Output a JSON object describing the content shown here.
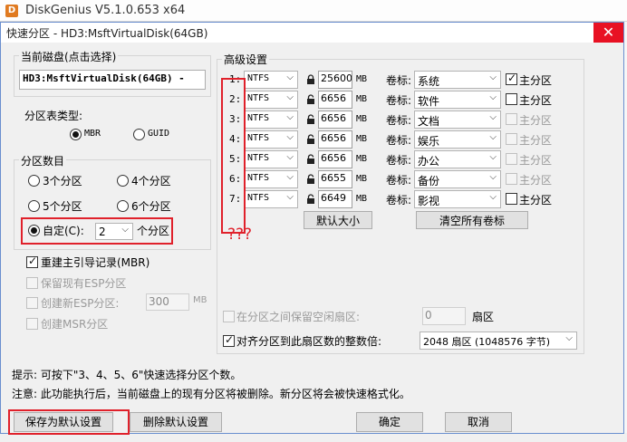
{
  "app": {
    "title": "DiskGenius V5.1.0.653 x64"
  },
  "dialog": {
    "title": "快速分区 - HD3:MsftVirtualDisk(64GB)",
    "close": "✕"
  },
  "disk": {
    "label": "当前磁盘(点击选择)",
    "value": "HD3:MsftVirtualDisk(64GB) -"
  },
  "table_type": {
    "label": "分区表类型:",
    "mbr": "MBR",
    "guid": "GUID",
    "selected": "MBR"
  },
  "count": {
    "label": "分区数目",
    "options": [
      "3个分区",
      "4个分区",
      "5个分区",
      "6个分区"
    ],
    "custom_label": "自定(C):",
    "custom_value": "2",
    "custom_suffix": "个分区"
  },
  "options": {
    "rebuild_mbr": "重建主引导记录(MBR)",
    "keep_esp": "保留现有ESP分区",
    "create_esp": "创建新ESP分区:",
    "esp_size": "300",
    "esp_unit": "MB",
    "create_msr": "创建MSR分区"
  },
  "advanced": {
    "label": "高级设置",
    "vol_label": "卷标:",
    "unit": "MB",
    "primary_label": "主分区",
    "rows": [
      {
        "index": "1:",
        "fs": "NTFS",
        "size": "25600",
        "locked": true,
        "label": "系统",
        "primary": true,
        "primary_enabled": true
      },
      {
        "index": "2:",
        "fs": "NTFS",
        "size": "6656",
        "locked": false,
        "label": "软件",
        "primary": false,
        "primary_enabled": true
      },
      {
        "index": "3:",
        "fs": "NTFS",
        "size": "6656",
        "locked": false,
        "label": "文档",
        "primary": false,
        "primary_enabled": false
      },
      {
        "index": "4:",
        "fs": "NTFS",
        "size": "6656",
        "locked": false,
        "label": "娱乐",
        "primary": false,
        "primary_enabled": false
      },
      {
        "index": "5:",
        "fs": "NTFS",
        "size": "6656",
        "locked": false,
        "label": "办公",
        "primary": false,
        "primary_enabled": false
      },
      {
        "index": "6:",
        "fs": "NTFS",
        "size": "6655",
        "locked": false,
        "label": "备份",
        "primary": false,
        "primary_enabled": false
      },
      {
        "index": "7:",
        "fs": "NTFS",
        "size": "6649",
        "locked": false,
        "label": "影视",
        "primary": false,
        "primary_enabled": true
      }
    ],
    "default_size_btn": "默认大小",
    "clear_labels_btn": "清空所有卷标",
    "annotation": "???",
    "keep_free_label": "在分区之间保留空闲扇区:",
    "keep_free_value": "0",
    "keep_free_unit": "扇区",
    "align_label": "对齐分区到此扇区数的整数倍:",
    "align_value": "2048 扇区 (1048576 字节)"
  },
  "hints": {
    "hint1": "提示: 可按下\"3、4、5、6\"快速选择分区个数。",
    "hint2": "注意: 此功能执行后，当前磁盘上的现有分区将被删除。新分区将会被快速格式化。"
  },
  "buttons": {
    "save_default": "保存为默认设置",
    "delete_default": "删除默认设置",
    "ok": "确定",
    "cancel": "取消"
  },
  "colors": {
    "highlight": "#e0212b",
    "close_bg": "#e81123"
  }
}
